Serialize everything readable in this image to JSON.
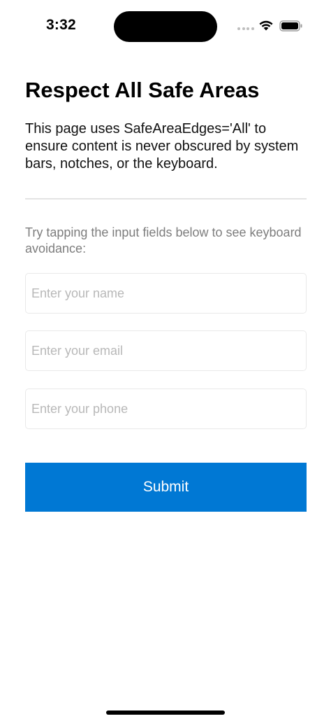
{
  "status_bar": {
    "time": "3:32",
    "icons": [
      "signal-dots-icon",
      "wifi-icon",
      "battery-icon"
    ]
  },
  "page": {
    "title": "Respect All Safe Areas",
    "description": "This page uses SafeAreaEdges='All' to ensure content is never obscured by system bars, notches, or the keyboard.",
    "hint": "Try tapping the input fields below to see keyboard avoidance:"
  },
  "form": {
    "name": {
      "value": "",
      "placeholder": "Enter your name"
    },
    "email": {
      "value": "",
      "placeholder": "Enter your email"
    },
    "phone": {
      "value": "",
      "placeholder": "Enter your phone"
    },
    "submit_label": "Submit"
  },
  "colors": {
    "accent": "#0078d4",
    "hint_text": "#7d7d7d",
    "placeholder": "#b8b8b8",
    "divider": "#e3e3e3"
  }
}
